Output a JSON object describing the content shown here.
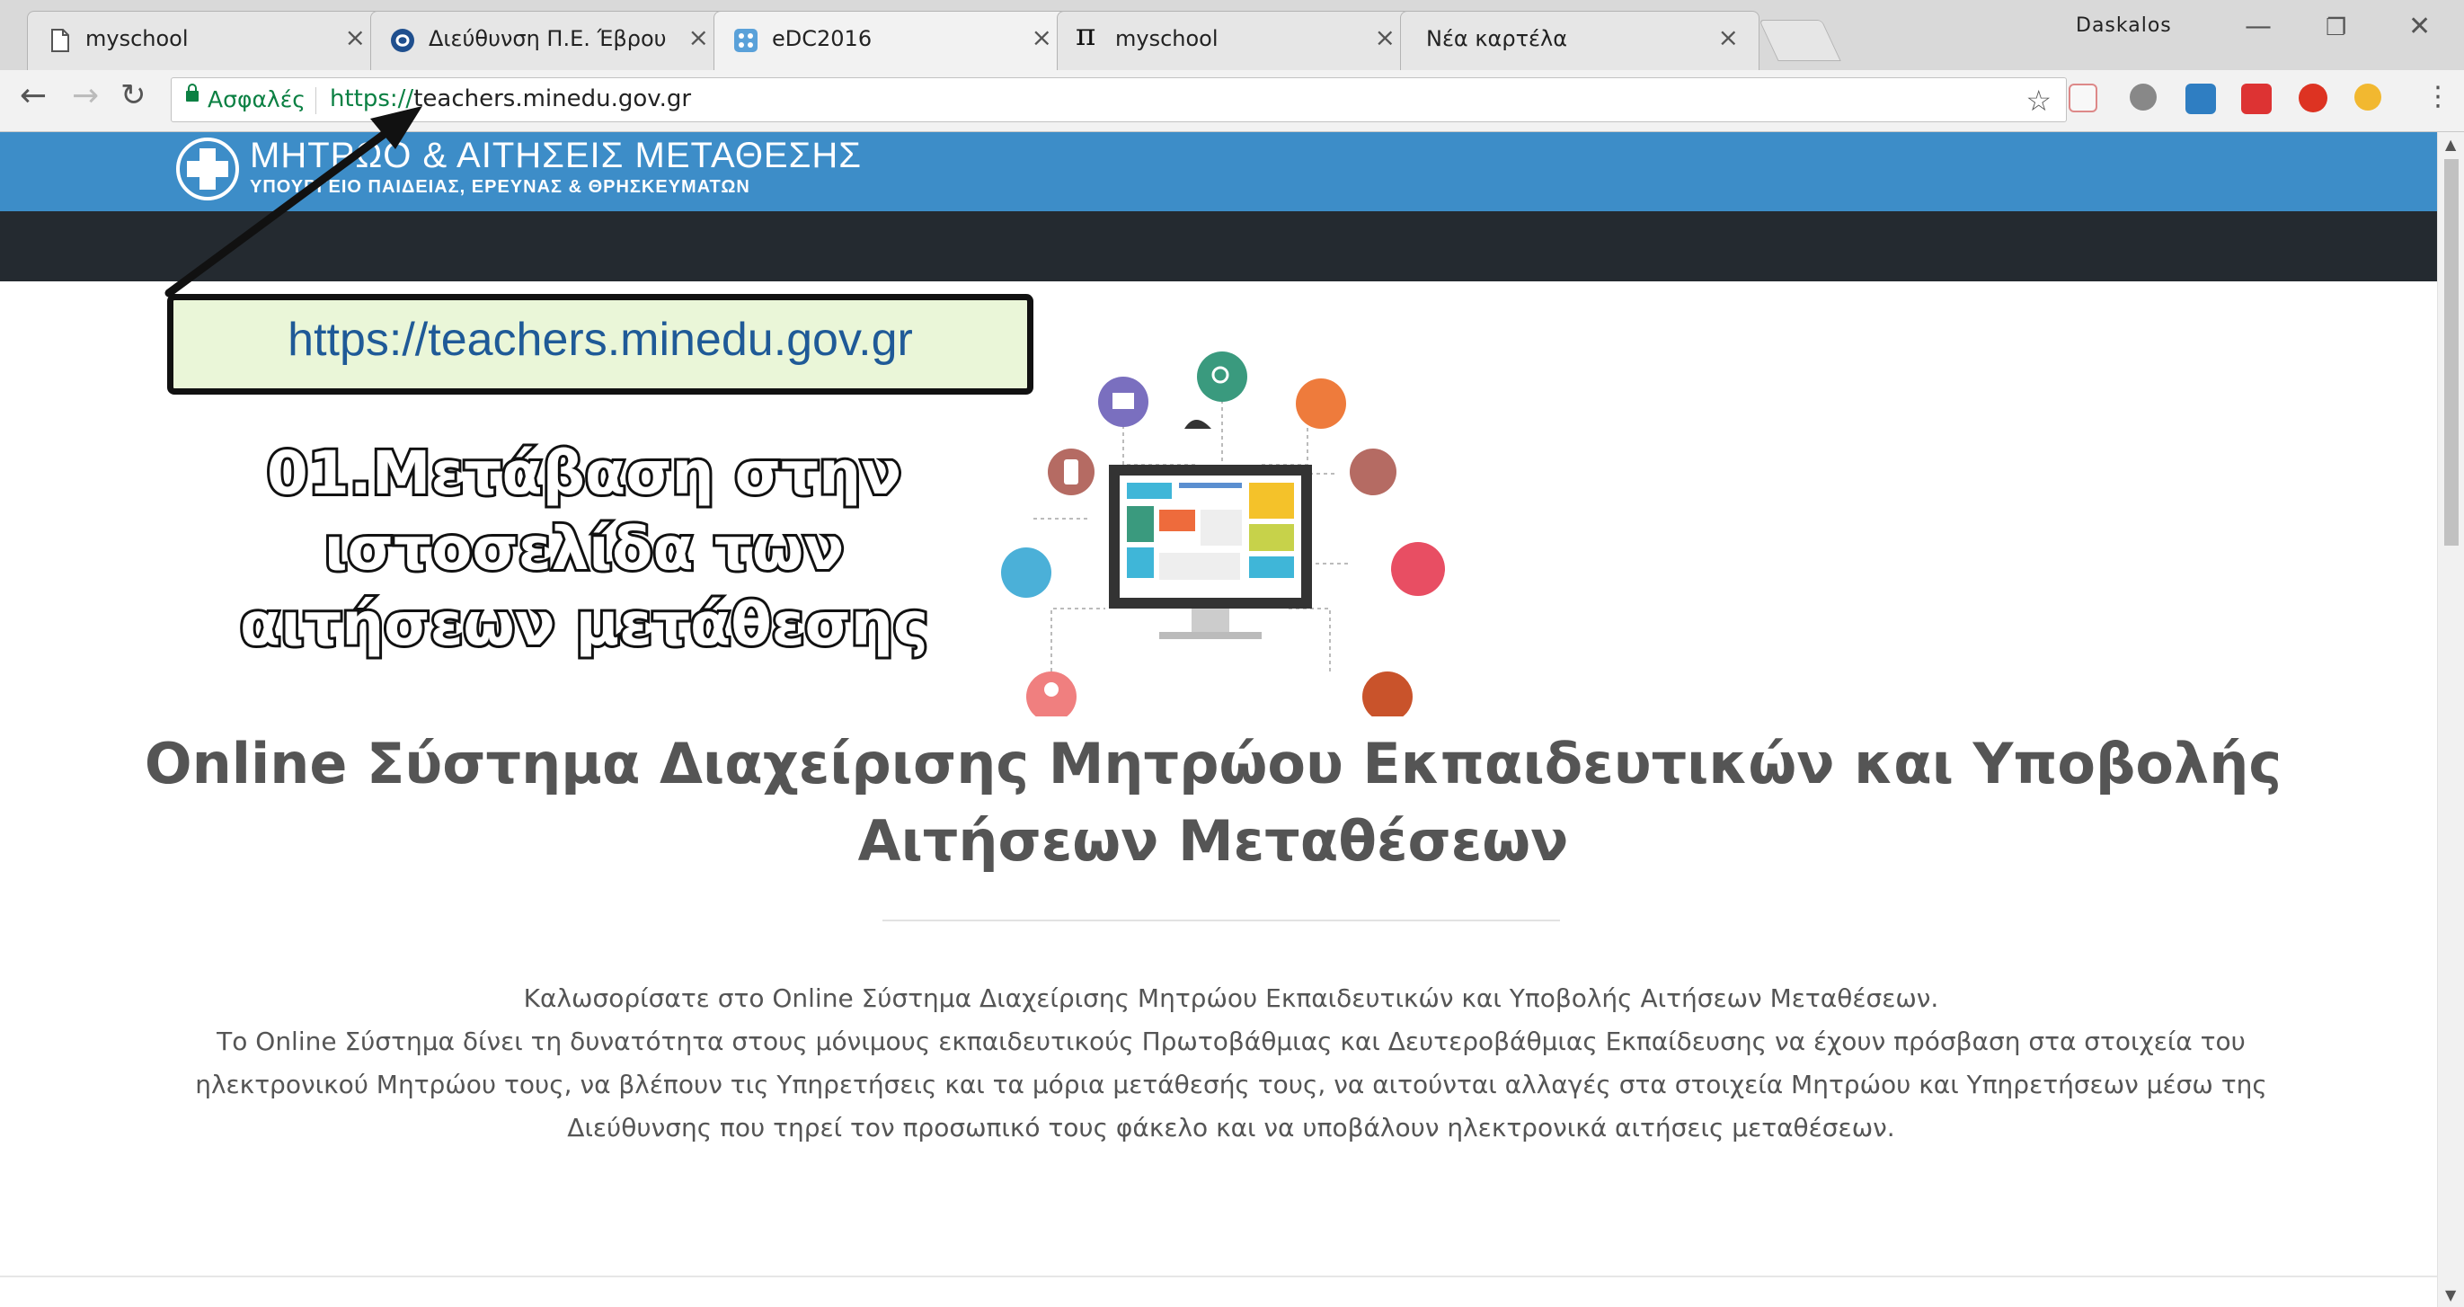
{
  "browser": {
    "tabs": [
      {
        "title": "myschool",
        "icon": "page-icon"
      },
      {
        "title": "Διεύθυνση Π.Ε. Έβρου",
        "icon": "joomla-icon"
      },
      {
        "title": "eDC2016",
        "icon": "grid-icon"
      },
      {
        "title": "myschool",
        "icon": "pi-icon"
      },
      {
        "title": "Νέα καρτέλα",
        "icon": "none"
      }
    ],
    "active_tab": 2,
    "profile_name": "Daskalos",
    "close_glyph": "×",
    "secure_label": "Ασφαλές",
    "url_scheme": "https://",
    "url_rest": "teachers.minedu.gov.gr"
  },
  "site": {
    "title": "ΜΗΤΡΩΟ & ΑΙΤΗΣΕΙΣ ΜΕΤΑΘΕΣΗΣ",
    "subtitle": "ΥΠΟΥΡΓΕΙΟ ΠΑΙΔΕΙΑΣ, ΕΡΕΥΝΑΣ & ΘΡΗΣΚΕΥΜΑΤΩΝ",
    "header_color": "#3d8dc8",
    "navbar_color": "#242a30"
  },
  "annotation": {
    "url_callout": "https://teachers.minedu.gov.gr",
    "step_caption": "01.Μετάβαση στην ιστοσελίδα των αιτήσεων μετάθεσης"
  },
  "main": {
    "title": "Online Σύστημα Διαχείρισης Μητρώου Εκπαιδευτικών και Υποβολής Αιτήσεων Μεταθέσεων",
    "welcome_line1": "Καλωσορίσατε στο Online Σύστημα Διαχείρισης Μητρώου Εκπαιδευτικών και Υποβολής Αιτήσεων Μεταθέσεων.",
    "welcome_line2": "Το Online Σύστημα δίνει τη δυνατότητα στους μόνιμους εκπαιδευτικούς Πρωτοβάθμιας και Δευτεροβάθμιας Εκπαίδευσης να έχουν πρόσβαση στα στοιχεία του ηλεκτρονικού Μητρώου τους, να βλέπουν τις Υπηρετήσεις και τα μόρια μετάθεσής τους, να αιτούνται αλλαγές στα στοιχεία Μητρώου και Υπηρετήσεων μέσω της Διεύθυνσης που τηρεί τον προσωπικό τους φάκελο και να υποβάλουν ηλεκτρονικά αιτήσεις μεταθέσεων."
  }
}
